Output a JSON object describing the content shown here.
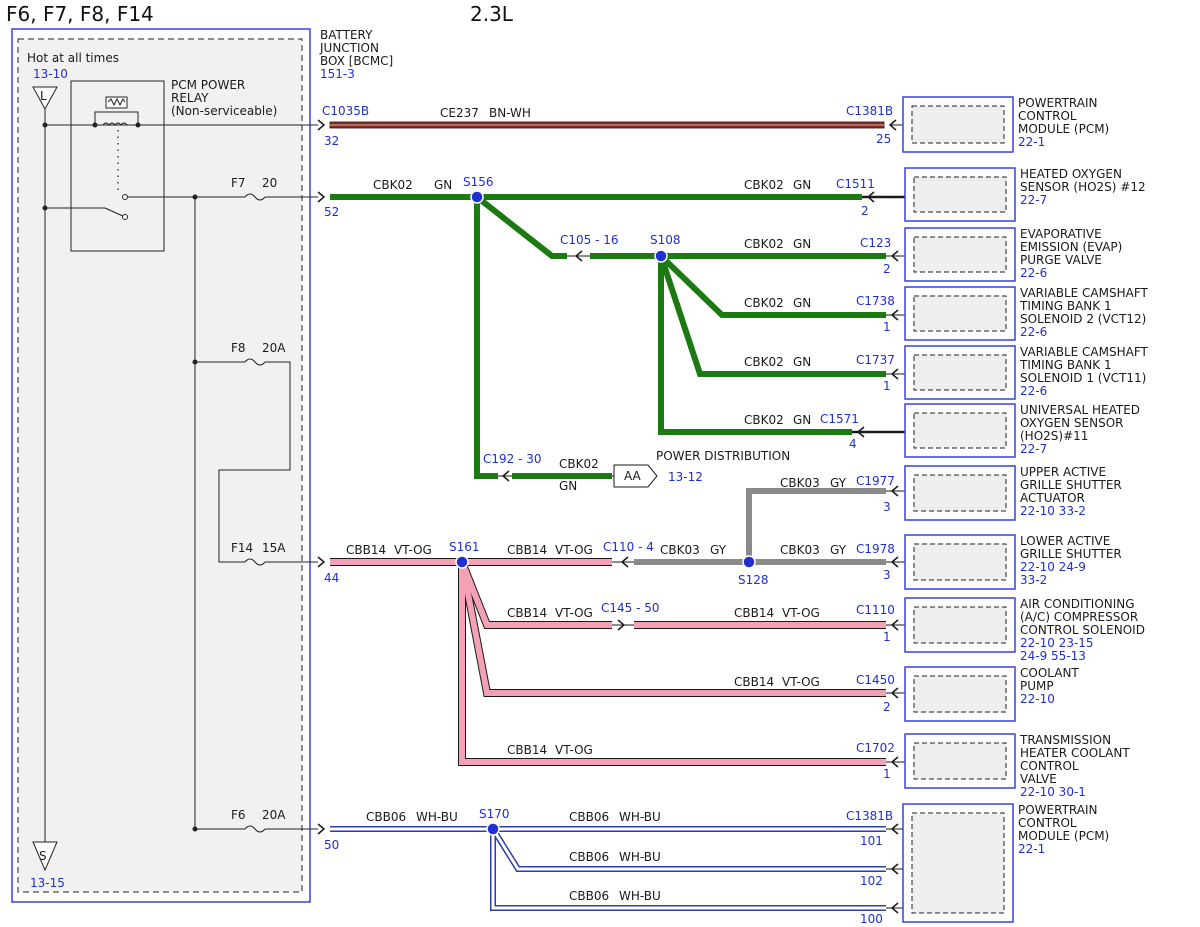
{
  "header": {
    "fuses_title": "F6, F7, F8, F14",
    "engine": "2.3L"
  },
  "colors": {
    "green": "#1b7a12",
    "brown": "#8b2a22",
    "pink": "#f2a2b4",
    "gray": "#8a8a8a",
    "wh_bu_center": "#ffffff",
    "wh_bu_edge": "#2b3fa3",
    "blue_text": "#1f2fd1",
    "component_fill": "#eeeeee"
  },
  "bjb": {
    "title_lines": [
      "BATTERY",
      "JUNCTION",
      "BOX [BCMC]"
    ],
    "ref": "151-3",
    "hot_label": "Hot at all times",
    "hot_ref": "13-10",
    "top_symbol": "L",
    "bottom_symbol": "S",
    "bottom_ref": "13-15",
    "relay_lines": [
      "PCM POWER",
      "RELAY",
      "(Non-serviceable)"
    ],
    "fuses": [
      {
        "name": "F7",
        "rating": "20"
      },
      {
        "name": "F8",
        "rating": "20A"
      },
      {
        "name": "F14",
        "rating": "15A"
      },
      {
        "name": "F6",
        "rating": "20A"
      }
    ]
  },
  "circuits": [
    {
      "label": "CE237",
      "color": "BN-WH",
      "out_connector": "C1035B",
      "out_pin": "32",
      "dest_connector": "C1381B",
      "dest_pin": "25"
    }
  ],
  "green_circuit": {
    "out_pin": "52",
    "splice_main": "S156",
    "splice_sub": "S108",
    "label": "CBK02",
    "color": "GN",
    "inline_1": "C105 - 16",
    "inline_2": "C192 - 30",
    "branches": [
      {
        "connector": "C1511",
        "pin": "2"
      },
      {
        "connector": "C123",
        "pin": "2"
      },
      {
        "connector": "C1738",
        "pin": "1"
      },
      {
        "connector": "C1737",
        "pin": "1"
      },
      {
        "connector": "C1571",
        "pin": "4"
      }
    ],
    "aa_tag": "AA",
    "power_dist": "POWER DISTRIBUTION",
    "power_dist_ref": "13-12"
  },
  "pink_circuit": {
    "out_pin": "44",
    "splice": "S161",
    "label": "CBB14",
    "color": "VT-OG",
    "inline_1": "C110 - 4",
    "inline_2": "C145 - 50",
    "gray_label": "CBK03",
    "gray_color": "GY",
    "gray_splice": "S128",
    "branches": [
      {
        "connector": "C1977",
        "pin": "3"
      },
      {
        "connector": "C1978",
        "pin": "3"
      },
      {
        "connector": "C1110",
        "pin": "1"
      },
      {
        "connector": "C1450",
        "pin": "2"
      },
      {
        "connector": "C1702",
        "pin": "1"
      }
    ]
  },
  "blue_circuit": {
    "out_pin": "50",
    "splice": "S170",
    "label": "CBB06",
    "color": "WH-BU",
    "dest_connector": "C1381B",
    "pins": [
      "101",
      "102",
      "100"
    ]
  },
  "components": [
    {
      "name": [
        "POWERTRAIN",
        "CONTROL",
        "MODULE (PCM)"
      ],
      "ref": [
        "22-1"
      ]
    },
    {
      "name": [
        "HEATED OXYGEN",
        "SENSOR (HO2S) #12"
      ],
      "ref": [
        "22-7"
      ]
    },
    {
      "name": [
        "EVAPORATIVE",
        "EMISSION (EVAP)",
        "PURGE VALVE"
      ],
      "ref": [
        "22-6"
      ]
    },
    {
      "name": [
        "VARIABLE CAMSHAFT",
        "TIMING BANK 1",
        "SOLENOID 2 (VCT12)"
      ],
      "ref": [
        "22-6"
      ]
    },
    {
      "name": [
        "VARIABLE CAMSHAFT",
        "TIMING BANK 1",
        "SOLENOID 1 (VCT11)"
      ],
      "ref": [
        "22-6"
      ]
    },
    {
      "name": [
        "UNIVERSAL HEATED",
        "OXYGEN SENSOR",
        "(HO2S)#11"
      ],
      "ref": [
        "22-7"
      ]
    },
    {
      "name": [
        "UPPER ACTIVE",
        "GRILLE SHUTTER",
        "ACTUATOR"
      ],
      "ref": [
        "22-10  33-2"
      ]
    },
    {
      "name": [
        "LOWER ACTIVE",
        "GRILLE SHUTTER"
      ],
      "ref": [
        "22-10  24-9",
        "33-2"
      ]
    },
    {
      "name": [
        "AIR CONDITIONING",
        "(A/C) COMPRESSOR",
        "CONTROL SOLENOID"
      ],
      "ref": [
        "22-10  23-15",
        "24-9   55-13"
      ]
    },
    {
      "name": [
        "COOLANT",
        "PUMP"
      ],
      "ref": [
        "22-10"
      ]
    },
    {
      "name": [
        "TRANSMISSION",
        "HEATER COOLANT",
        "CONTROL",
        "VALVE"
      ],
      "ref": [
        "22-10  30-1"
      ]
    },
    {
      "name": [
        "POWERTRAIN",
        "CONTROL",
        "MODULE (PCM)"
      ],
      "ref": [
        "22-1"
      ]
    }
  ]
}
